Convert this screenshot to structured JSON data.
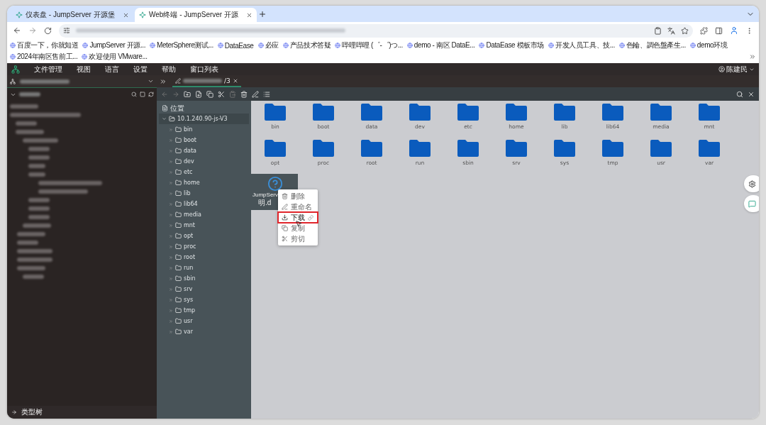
{
  "browser": {
    "tabs": [
      {
        "title": "仪表盘 - JumpServer 开源堡",
        "selected": false
      },
      {
        "title": "Web终端 - JumpServer 开源",
        "selected": true
      }
    ],
    "bookmarks": [
      "百度一下，你就知道",
      "JumpServer 开源...",
      "MeterSphere测试...",
      "DataEase",
      "必应",
      "产品技术答疑",
      "哔哩哔哩 (゜-゜)つ...",
      "demo - 南区 DataE...",
      "DataEase 模板市场",
      "开发人员工具、技...",
      "色輪、調色盤產生...",
      "demo环境",
      "2024年南区售前工...",
      "欢迎使用 VMware..."
    ]
  },
  "app": {
    "menu": [
      "文件管理",
      "视图",
      "语言",
      "设置",
      "帮助",
      "窗口列表"
    ],
    "user": "陈建民",
    "session_tab": {
      "title": "/3"
    },
    "sidebar": {
      "footer": "类型树"
    },
    "location_label": "位置",
    "tree": {
      "name": "10.1.240.90-js-V3",
      "expanded": true,
      "children": [
        "bin",
        "boot",
        "data",
        "dev",
        "etc",
        "home",
        "lib",
        "lib64",
        "media",
        "mnt",
        "opt",
        "proc",
        "root",
        "run",
        "sbin",
        "srv",
        "sys",
        "tmp",
        "usr",
        "var"
      ]
    },
    "folders": [
      "bin",
      "boot",
      "data",
      "dev",
      "etc",
      "home",
      "lib",
      "lib64",
      "media",
      "mnt",
      "opt",
      "proc",
      "root",
      "run",
      "sbin",
      "srv",
      "sys",
      "tmp",
      "usr",
      "var"
    ],
    "file": {
      "lines": [
        "JumpServ",
        "明.d"
      ]
    },
    "context_menu": [
      {
        "label": "删除",
        "kind": "delete",
        "selected": false
      },
      {
        "label": "重命名",
        "kind": "rename",
        "selected": false
      },
      {
        "label": "下载",
        "kind": "download",
        "selected": true
      },
      {
        "label": "复制",
        "kind": "copy",
        "selected": false
      },
      {
        "label": "剪切",
        "kind": "cut",
        "selected": false
      }
    ]
  }
}
